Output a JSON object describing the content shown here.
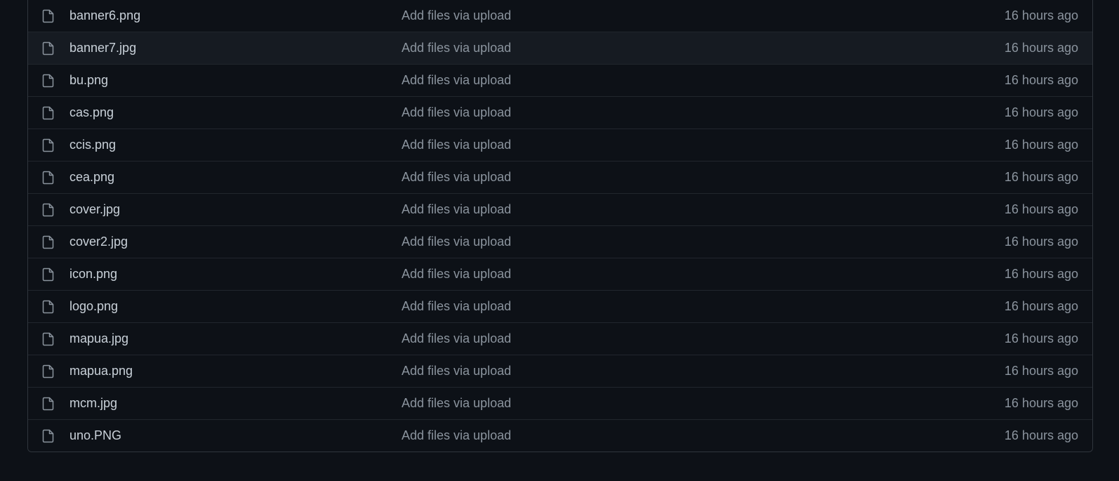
{
  "files": [
    {
      "name": "banner6.png",
      "message": "Add files via upload",
      "age": "16 hours ago",
      "icon": "file-icon"
    },
    {
      "name": "banner7.jpg",
      "message": "Add files via upload",
      "age": "16 hours ago",
      "icon": "file-icon"
    },
    {
      "name": "bu.png",
      "message": "Add files via upload",
      "age": "16 hours ago",
      "icon": "file-icon"
    },
    {
      "name": "cas.png",
      "message": "Add files via upload",
      "age": "16 hours ago",
      "icon": "file-icon"
    },
    {
      "name": "ccis.png",
      "message": "Add files via upload",
      "age": "16 hours ago",
      "icon": "file-icon"
    },
    {
      "name": "cea.png",
      "message": "Add files via upload",
      "age": "16 hours ago",
      "icon": "file-icon"
    },
    {
      "name": "cover.jpg",
      "message": "Add files via upload",
      "age": "16 hours ago",
      "icon": "file-icon"
    },
    {
      "name": "cover2.jpg",
      "message": "Add files via upload",
      "age": "16 hours ago",
      "icon": "file-icon"
    },
    {
      "name": "icon.png",
      "message": "Add files via upload",
      "age": "16 hours ago",
      "icon": "file-icon"
    },
    {
      "name": "logo.png",
      "message": "Add files via upload",
      "age": "16 hours ago",
      "icon": "file-icon"
    },
    {
      "name": "mapua.jpg",
      "message": "Add files via upload",
      "age": "16 hours ago",
      "icon": "file-icon"
    },
    {
      "name": "mapua.png",
      "message": "Add files via upload",
      "age": "16 hours ago",
      "icon": "file-icon"
    },
    {
      "name": "mcm.jpg",
      "message": "Add files via upload",
      "age": "16 hours ago",
      "icon": "file-icon"
    },
    {
      "name": "uno.PNG",
      "message": "Add files via upload",
      "age": "16 hours ago",
      "icon": "file-icon"
    }
  ],
  "colors": {
    "background": "#0d1117",
    "row_hover": "#161b22",
    "border": "#30363d",
    "text_primary": "#c9d1d9",
    "text_muted": "#8b949e"
  }
}
